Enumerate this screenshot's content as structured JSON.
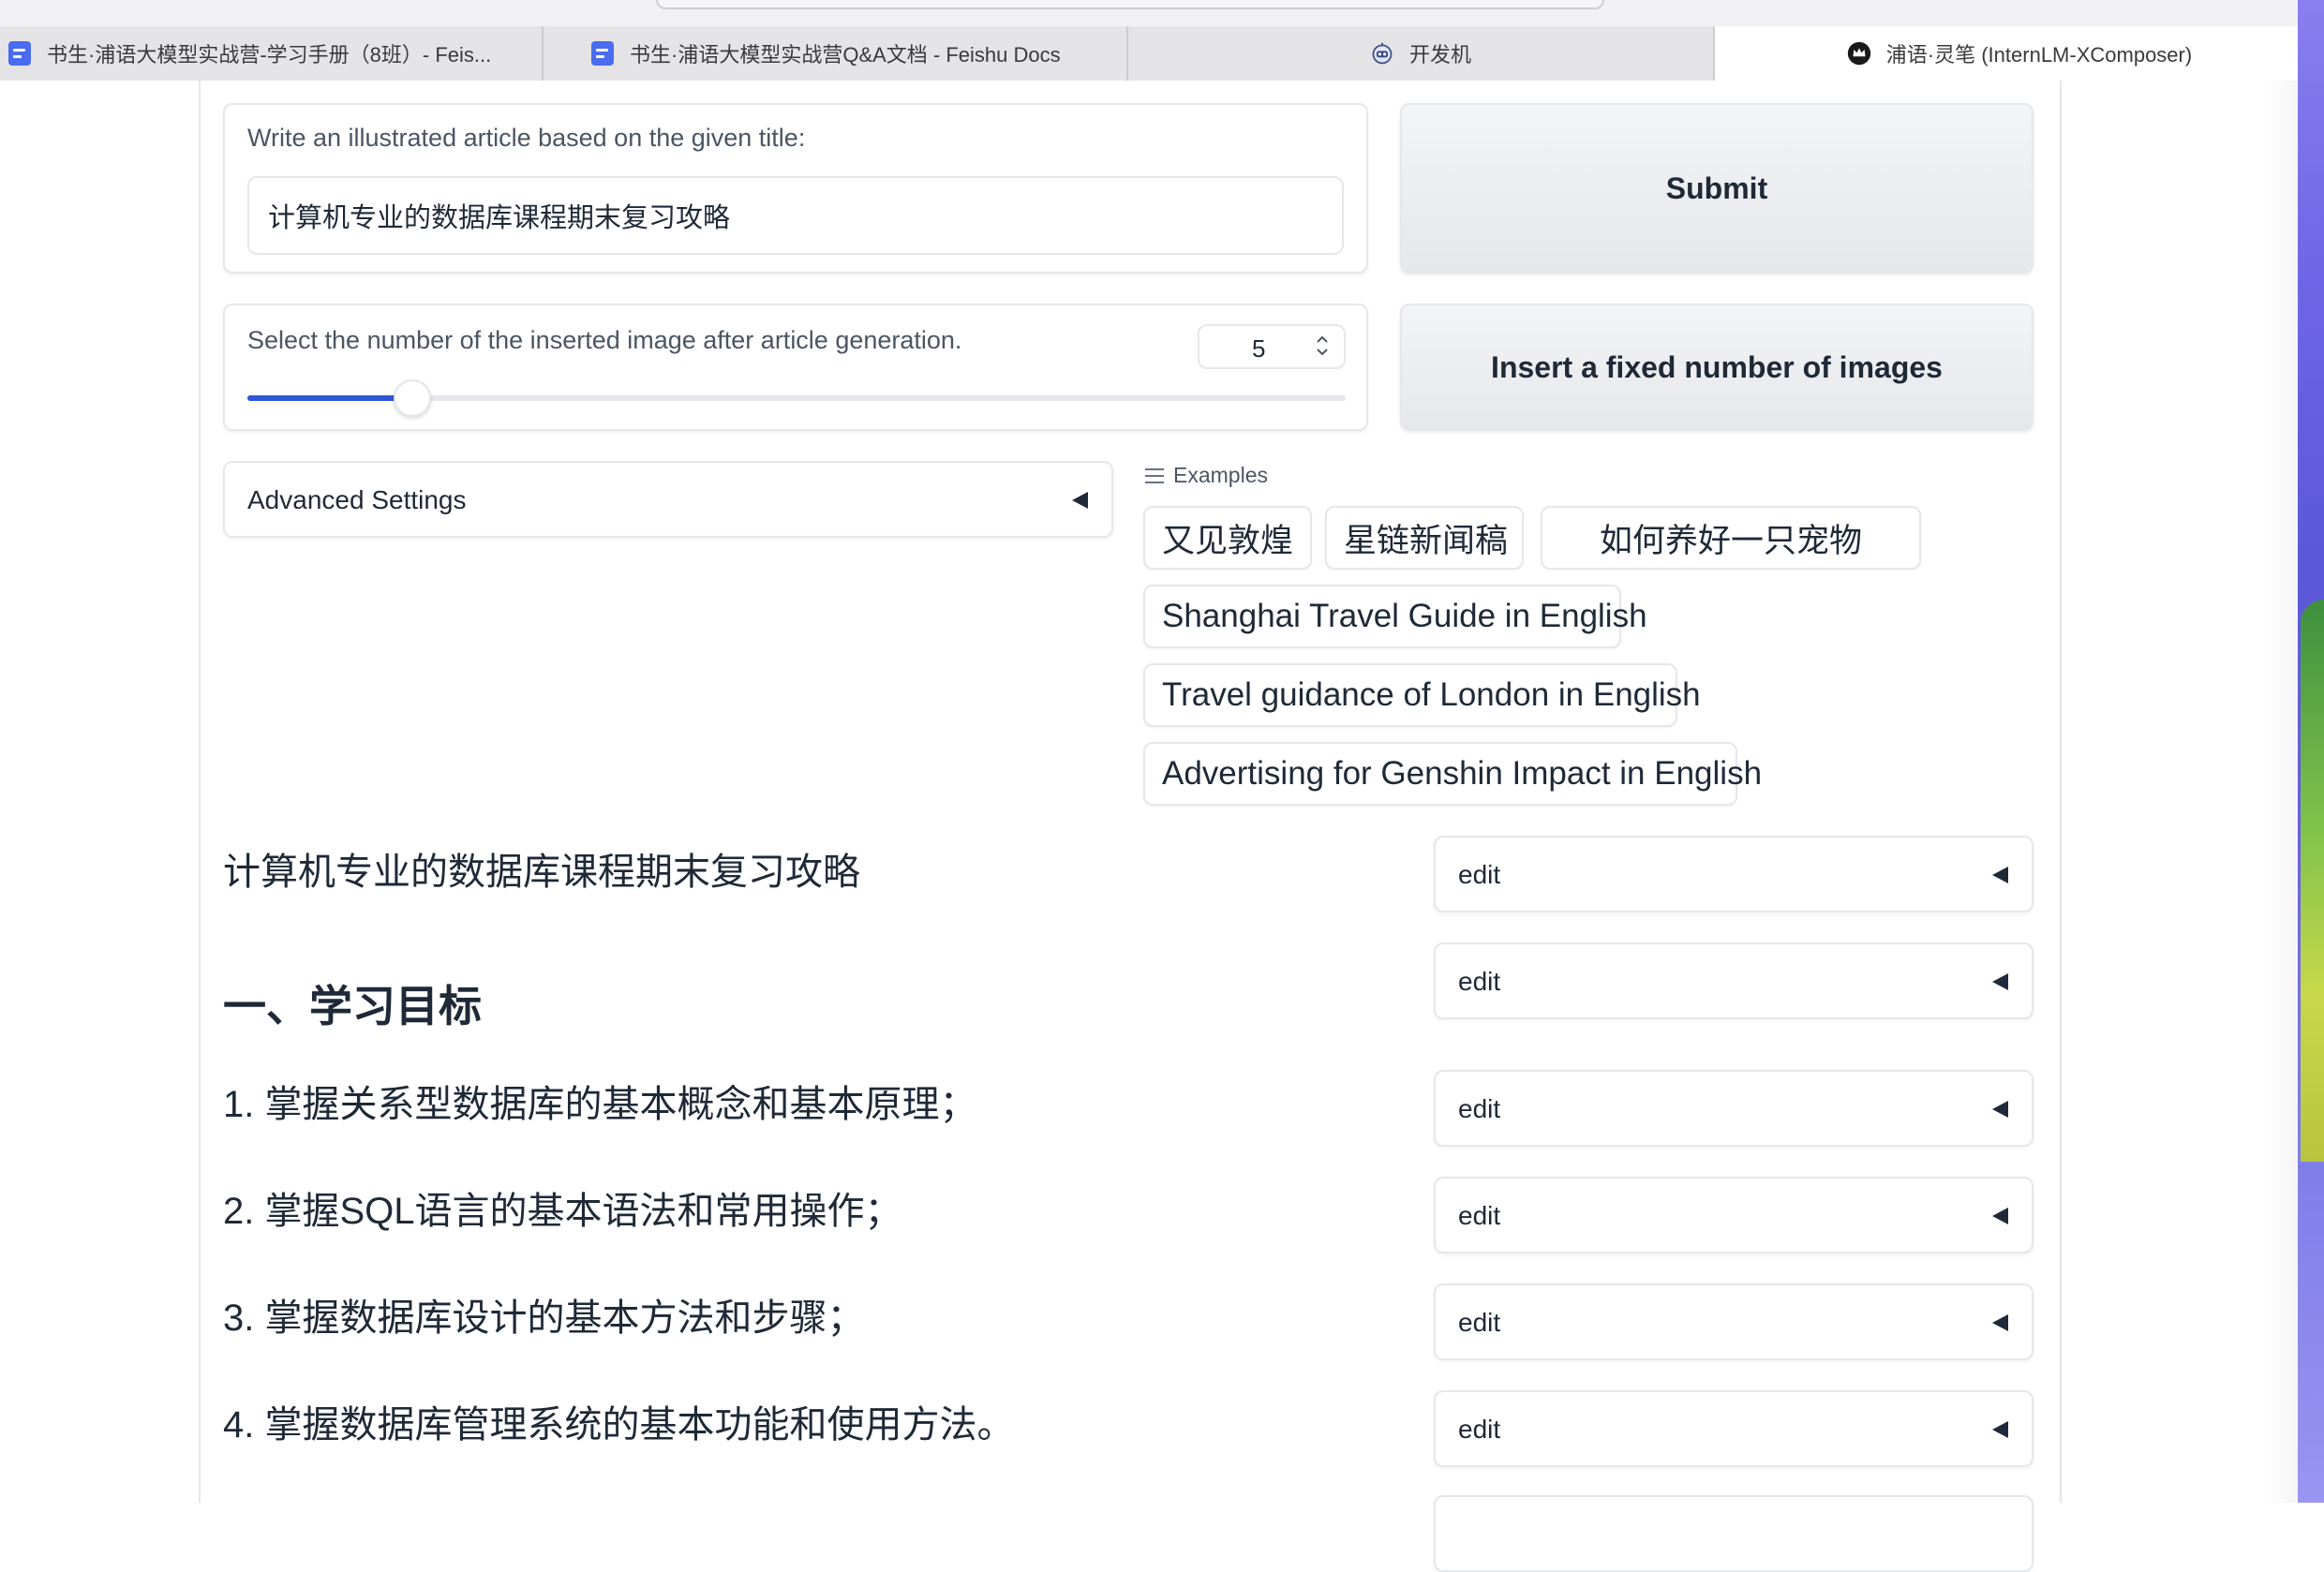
{
  "browser": {
    "tabs": [
      {
        "label": "书生·浦语大模型实战营-学习手册（8班）- Feis...",
        "icon": "doc-icon"
      },
      {
        "label": "书生·浦语大模型实战营Q&A文档 - Feishu Docs",
        "icon": "doc-icon"
      },
      {
        "label": "开发机",
        "icon": "robot-icon"
      },
      {
        "label": "浦语·灵笔 (InternLM-XComposer)",
        "icon": "crown-logo-icon",
        "active": true
      }
    ]
  },
  "article": {
    "title_label": "Write an illustrated article based on the given title:",
    "title_value": "计算机专业的数据库课程期末复习攻略",
    "submit_label": "Submit"
  },
  "images": {
    "slider_label": "Select the number of the inserted image after article generation.",
    "count_value": "5",
    "slider_fraction": 0.15,
    "insert_label": "Insert a fixed number of images"
  },
  "advanced": {
    "label": "Advanced Settings"
  },
  "examples": {
    "header": "Examples",
    "items": [
      "又见敦煌",
      "星链新闻稿",
      "如何养好一只宠物",
      "Shanghai Travel Guide in English",
      "Travel guidance of London in English",
      "Advertising for Genshin Impact in English"
    ]
  },
  "output": {
    "lines": [
      "计算机专业的数据库课程期末复习攻略",
      "一、学习目标",
      "1. 掌握关系型数据库的基本概念和基本原理；",
      "2. 掌握SQL语言的基本语法和常用操作；",
      "3. 掌握数据库设计的基本方法和步骤；",
      "4. 掌握数据库管理系统的基本功能和使用方法。"
    ],
    "edit_label": "edit"
  },
  "colors": {
    "accent": "#2f56d8",
    "border": "#e5e7eb",
    "button_bg": "#e5e7eb"
  }
}
